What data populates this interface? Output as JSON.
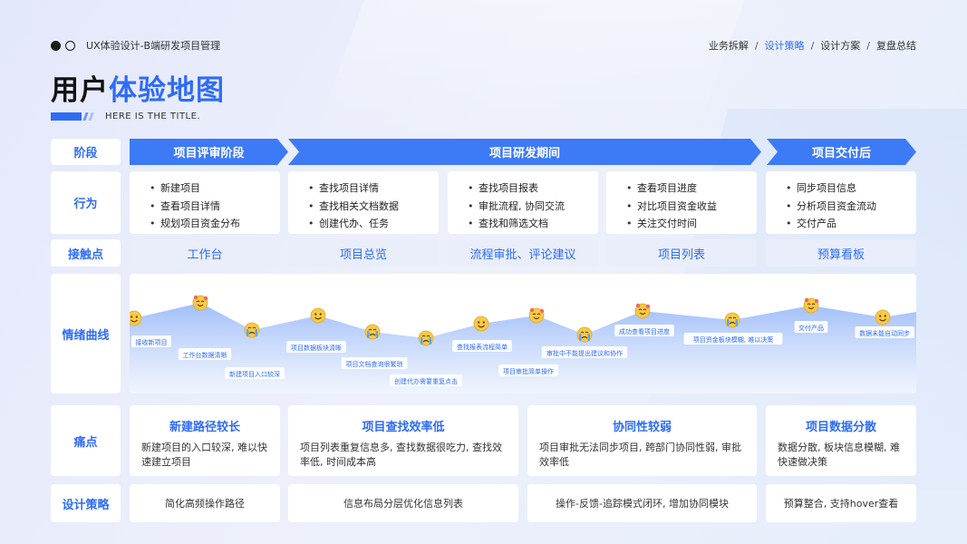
{
  "header": {
    "brand": "UX体验设计-B端研发项目管理",
    "nav": [
      {
        "label": "业务拆解",
        "active": false
      },
      {
        "label": "设计策略",
        "active": true
      },
      {
        "label": "设计方案",
        "active": false
      },
      {
        "label": "复盘总结",
        "active": false
      }
    ],
    "title_part1": "用户",
    "title_part2": "体验地图",
    "subtitle": "HERE IS THE TITLE."
  },
  "row_labels": {
    "stage": "阶段",
    "behavior": "行为",
    "touchpoint": "接触点",
    "emotion": "情绪曲线",
    "pain": "痛点",
    "strategy": "设计策略"
  },
  "stages": [
    "项目评审阶段",
    "项目研发期间",
    "项目交付后"
  ],
  "behaviors": [
    [
      "新建项目",
      "查看项目详情",
      "规划项目资金分布"
    ],
    [
      "查找项目详情",
      "查找相关文档数据",
      "创建代办、任务"
    ],
    [
      "查找项目报表",
      "审批流程, 协同交流",
      "查找和筛选文档"
    ],
    [
      "查看项目进度",
      "对比项目资金收益",
      "关注交付时间"
    ],
    [
      "同步项目信息",
      "分析项目资金流动",
      "交付产品"
    ]
  ],
  "touchpoints": [
    "工作台",
    "项目总览",
    "流程审批、评论建议",
    "项目列表",
    "预算看板"
  ],
  "emotion_chart": {
    "points": [
      {
        "label": "接收新项目",
        "mood": "neutral"
      },
      {
        "label": "工作台数据清晰",
        "mood": "happy"
      },
      {
        "label": "新建项目入口较深",
        "mood": "sad"
      },
      {
        "label": "项目数据板块清晰",
        "mood": "neutral"
      },
      {
        "label": "项目文档查询很繁琐",
        "mood": "sad"
      },
      {
        "label": "创建代办需要重复点击",
        "mood": "sad"
      },
      {
        "label": "查找报表流程简单",
        "mood": "neutral"
      },
      {
        "label": "项目审批简单操作",
        "mood": "happy"
      },
      {
        "label": "审批中不能提出建议和协作",
        "mood": "sad"
      },
      {
        "label": "成功查看项目进度",
        "mood": "happy"
      },
      {
        "label": "项目资金板块模糊, 难以决策",
        "mood": "sad"
      },
      {
        "label": "交付产品",
        "mood": "happy"
      },
      {
        "label": "数据未能自动同步",
        "mood": "neutral"
      }
    ]
  },
  "pain_points": [
    {
      "title": "新建路径较长",
      "desc": "新建项目的入口较深, 难以快速建立项目"
    },
    {
      "title": "项目查找效率低",
      "desc": "项目列表重复信息多, 查找数据很吃力, 查找效率低, 时间成本高"
    },
    {
      "title": "协同性较弱",
      "desc": "项目审批无法同步项目, 跨部门协同性弱, 审批效率低"
    },
    {
      "title": "项目数据分散",
      "desc": "数据分散, 板块信息模糊, 难快速做决策"
    }
  ],
  "strategies": [
    "简化高频操作路径",
    "信息布局分层优化信息列表",
    "操作-反馈-追踪模式闭环, 增加协同模块",
    "预算整合, 支持hover查看"
  ],
  "colors": {
    "accent": "#2f6cf5",
    "stage_fill": "#3d7af6",
    "emoji": "#f7c948",
    "love_emoji": "#f56565"
  }
}
